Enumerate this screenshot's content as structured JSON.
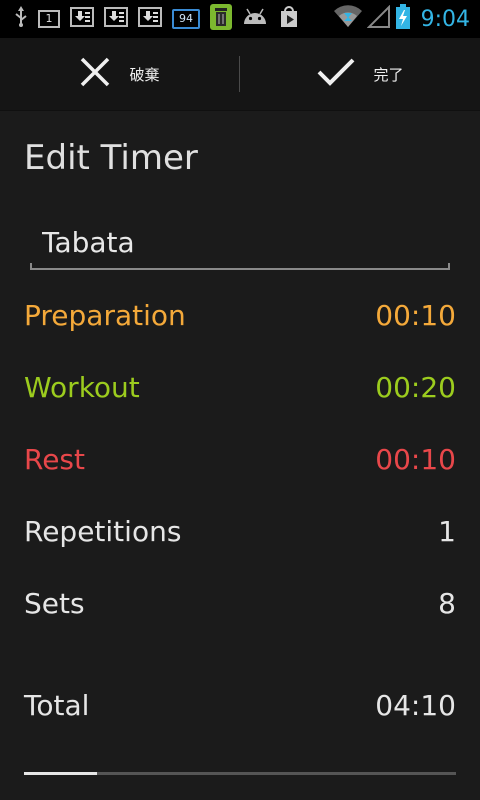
{
  "status_bar": {
    "time": "9:04",
    "notification_box_label": "1",
    "badge_label": "94",
    "time_color": "#33b5e5"
  },
  "action_bar": {
    "discard_label": "破棄",
    "done_label": "完了"
  },
  "page": {
    "title": "Edit Timer"
  },
  "timer_name": {
    "value": "Tabata"
  },
  "rows": [
    {
      "label": "Preparation",
      "value": "00:10",
      "color": "#f4a93a"
    },
    {
      "label": "Workout",
      "value": "00:20",
      "color": "#9ccc1e"
    },
    {
      "label": "Rest",
      "value": "00:10",
      "color": "#e8474a"
    },
    {
      "label": "Repetitions",
      "value": "1",
      "color": "#e6e6e6"
    },
    {
      "label": "Sets",
      "value": "8",
      "color": "#e6e6e6"
    }
  ],
  "total": {
    "label": "Total",
    "value": "04:10"
  },
  "scroll_progress": 0.17
}
